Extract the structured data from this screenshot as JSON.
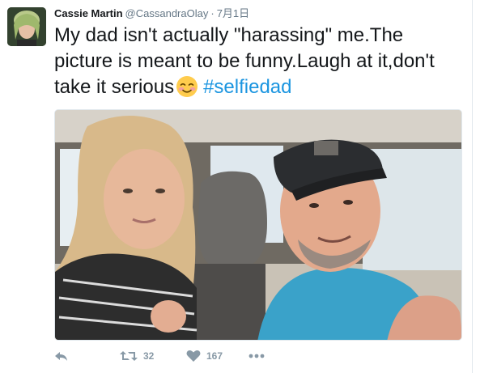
{
  "tweet": {
    "author": {
      "full_name": "Cassie Martin",
      "username": "@CassandraOlay",
      "avatar_icon": "profile-photo"
    },
    "separator": "·",
    "timestamp": "7月1日",
    "text": "My dad isn't actually \"harassing\" me.The picture is meant to be funny.Laugh at it,don't take it serious",
    "emoji": "smiling-face-with-blush-emoji",
    "hashtag": "#selfiedad",
    "actions": {
      "reply_icon": "reply-icon",
      "retweet_count": "32",
      "like_count": "167",
      "more_icon": "more-icon"
    }
  },
  "colors": {
    "text": "#14171a",
    "secondary": "#657786",
    "link": "#1b95e0",
    "action": "#8899a6",
    "border": "#e1e8ed"
  }
}
